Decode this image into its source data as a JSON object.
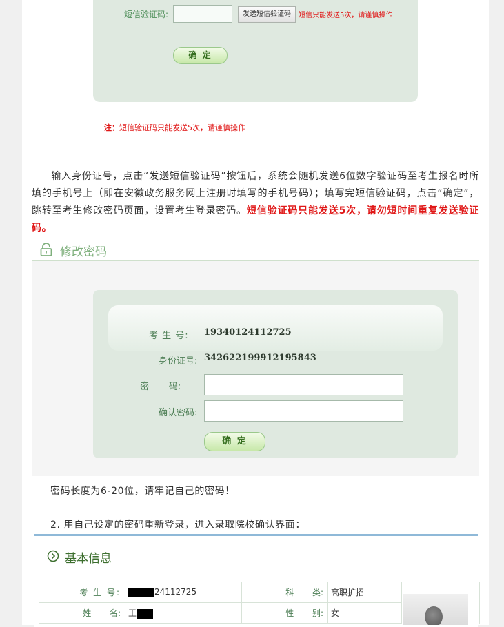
{
  "sms": {
    "label": "短信验证码:",
    "send_button": "发送短信验证码",
    "warning": "短信只能发送5次，请谨慎操作",
    "confirm": "确 定",
    "note_prefix": "注：",
    "note_text": "短信验证码只能发送5次，请谨慎操作"
  },
  "instruction": {
    "text": "输入身份证号，点击“发送短信验证码”按钮后，系统会随机发送6位数字验证码至考生报名时所填的手机号上（即在安徽政务服务网上注册时填写的手机号码）；填写完短信验证码，点击“确定”，跳转至考生修改密码页面，设置考生登录密码。",
    "highlight": "短信验证码只能发送5次，请勿短时间重复发送验证码。"
  },
  "change_password": {
    "title": "修改密码",
    "examinee_no_label": "考 生 号:",
    "examinee_no": "19340124112725",
    "id_label": "身份证号:",
    "id_value": "342622199912195843",
    "password_label": "密       码:",
    "confirm_label": "确认密码:",
    "confirm": "确 定"
  },
  "password_note": "密码长度为6-20位，请牢记自己的密码！",
  "step2": "2. 用自己设定的密码重新登录，进入录取院校确认界面：",
  "basic_info": {
    "title": "基本信息",
    "rows": [
      {
        "label1": "考 生 号:",
        "value1": "24112725",
        "label2": "科       类:",
        "value2": "高职扩招"
      },
      {
        "label1": "姓       名:",
        "value1": "王",
        "label2": "性       别:",
        "value2": "女"
      }
    ]
  },
  "colors": {
    "accent_green": "#7fb07d",
    "warning_red": "#e01818",
    "panel_bg": "#dfe9e0"
  },
  "icons": {
    "lock": "lock-icon",
    "circle_arrow": "circle-arrow-icon"
  }
}
